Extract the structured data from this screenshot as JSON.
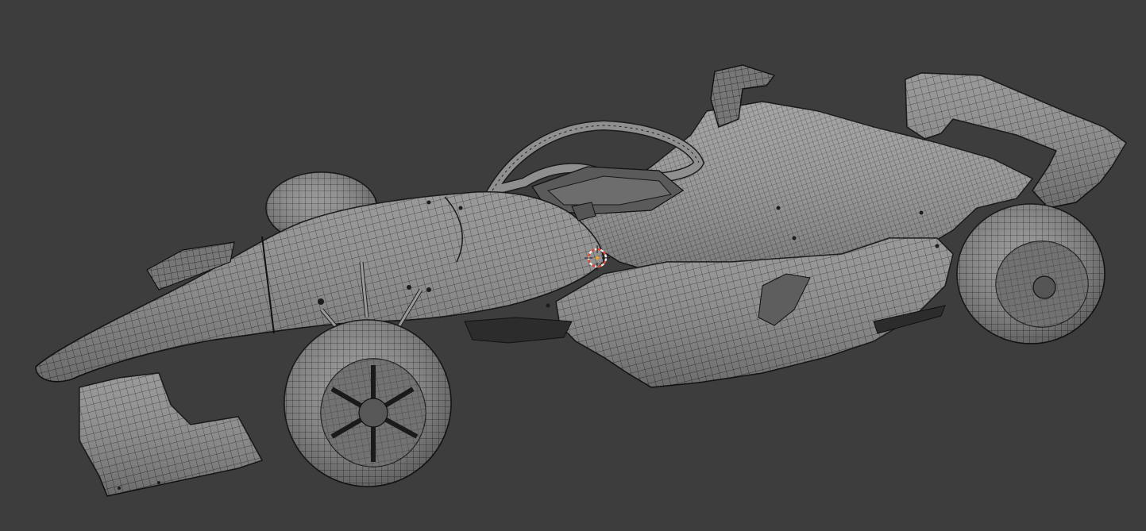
{
  "viewport": {
    "background": "#3d3d3d",
    "mode": "wireframe-on-shaded",
    "object": "open-wheel-race-car-mesh"
  },
  "colors": {
    "surface": "#8c8c8c",
    "surface_light": "#a3a3a3",
    "surface_dark": "#6f6f6f",
    "wire": "#1e1e1e",
    "cursor_ring_red": "#e04a3a",
    "cursor_ring_white": "#f0f0f0",
    "cursor_center": "#f2a02a"
  },
  "icons": {
    "cursor": "3d-cursor-icon"
  }
}
